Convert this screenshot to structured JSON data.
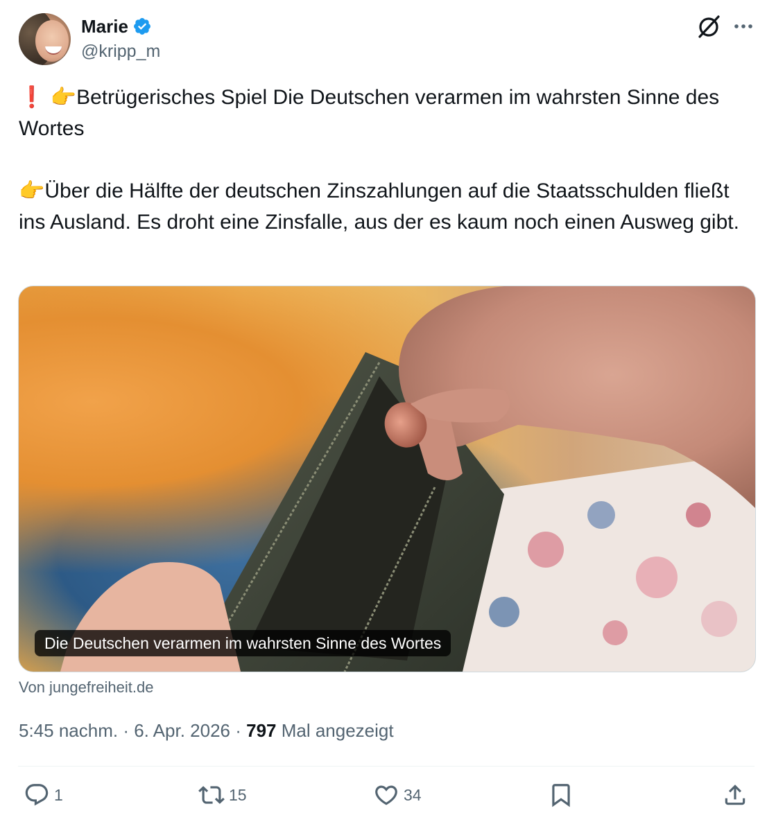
{
  "author": {
    "name": "Marie",
    "handle": "@kripp_m",
    "verified": true,
    "verified_color": "#1d9bf0"
  },
  "tweet": {
    "line1_emoji_1": "❗",
    "line1_emoji_2": "👉",
    "line1_text": "Betrügerisches Spiel Die Deutschen verarmen im wahrsten Sinne des Wortes",
    "line2_emoji": "👉",
    "line2_text": "Über die Hälfte der deutschen Zinszahlungen auf die Staatsschulden fließt ins Ausland. Es droht eine Zinsfalle, aus der es kaum noch einen Ausweg gibt."
  },
  "media": {
    "caption": "Die Deutschen verarmen im wahrsten Sinne des Wortes",
    "source": "Von jungefreiheit.de"
  },
  "meta": {
    "time": "5:45 nachm.",
    "separator": " · ",
    "date": "6. Apr. 2026",
    "views": "797",
    "views_label": " Mal angezeigt"
  },
  "actions": {
    "replies": "1",
    "reposts": "15",
    "likes": "34"
  },
  "icons": {
    "header_right_1": "grok-icon",
    "header_right_2": "more-icon",
    "action_icons": [
      "reply-icon",
      "repost-icon",
      "like-icon",
      "bookmark-icon",
      "share-icon"
    ]
  }
}
